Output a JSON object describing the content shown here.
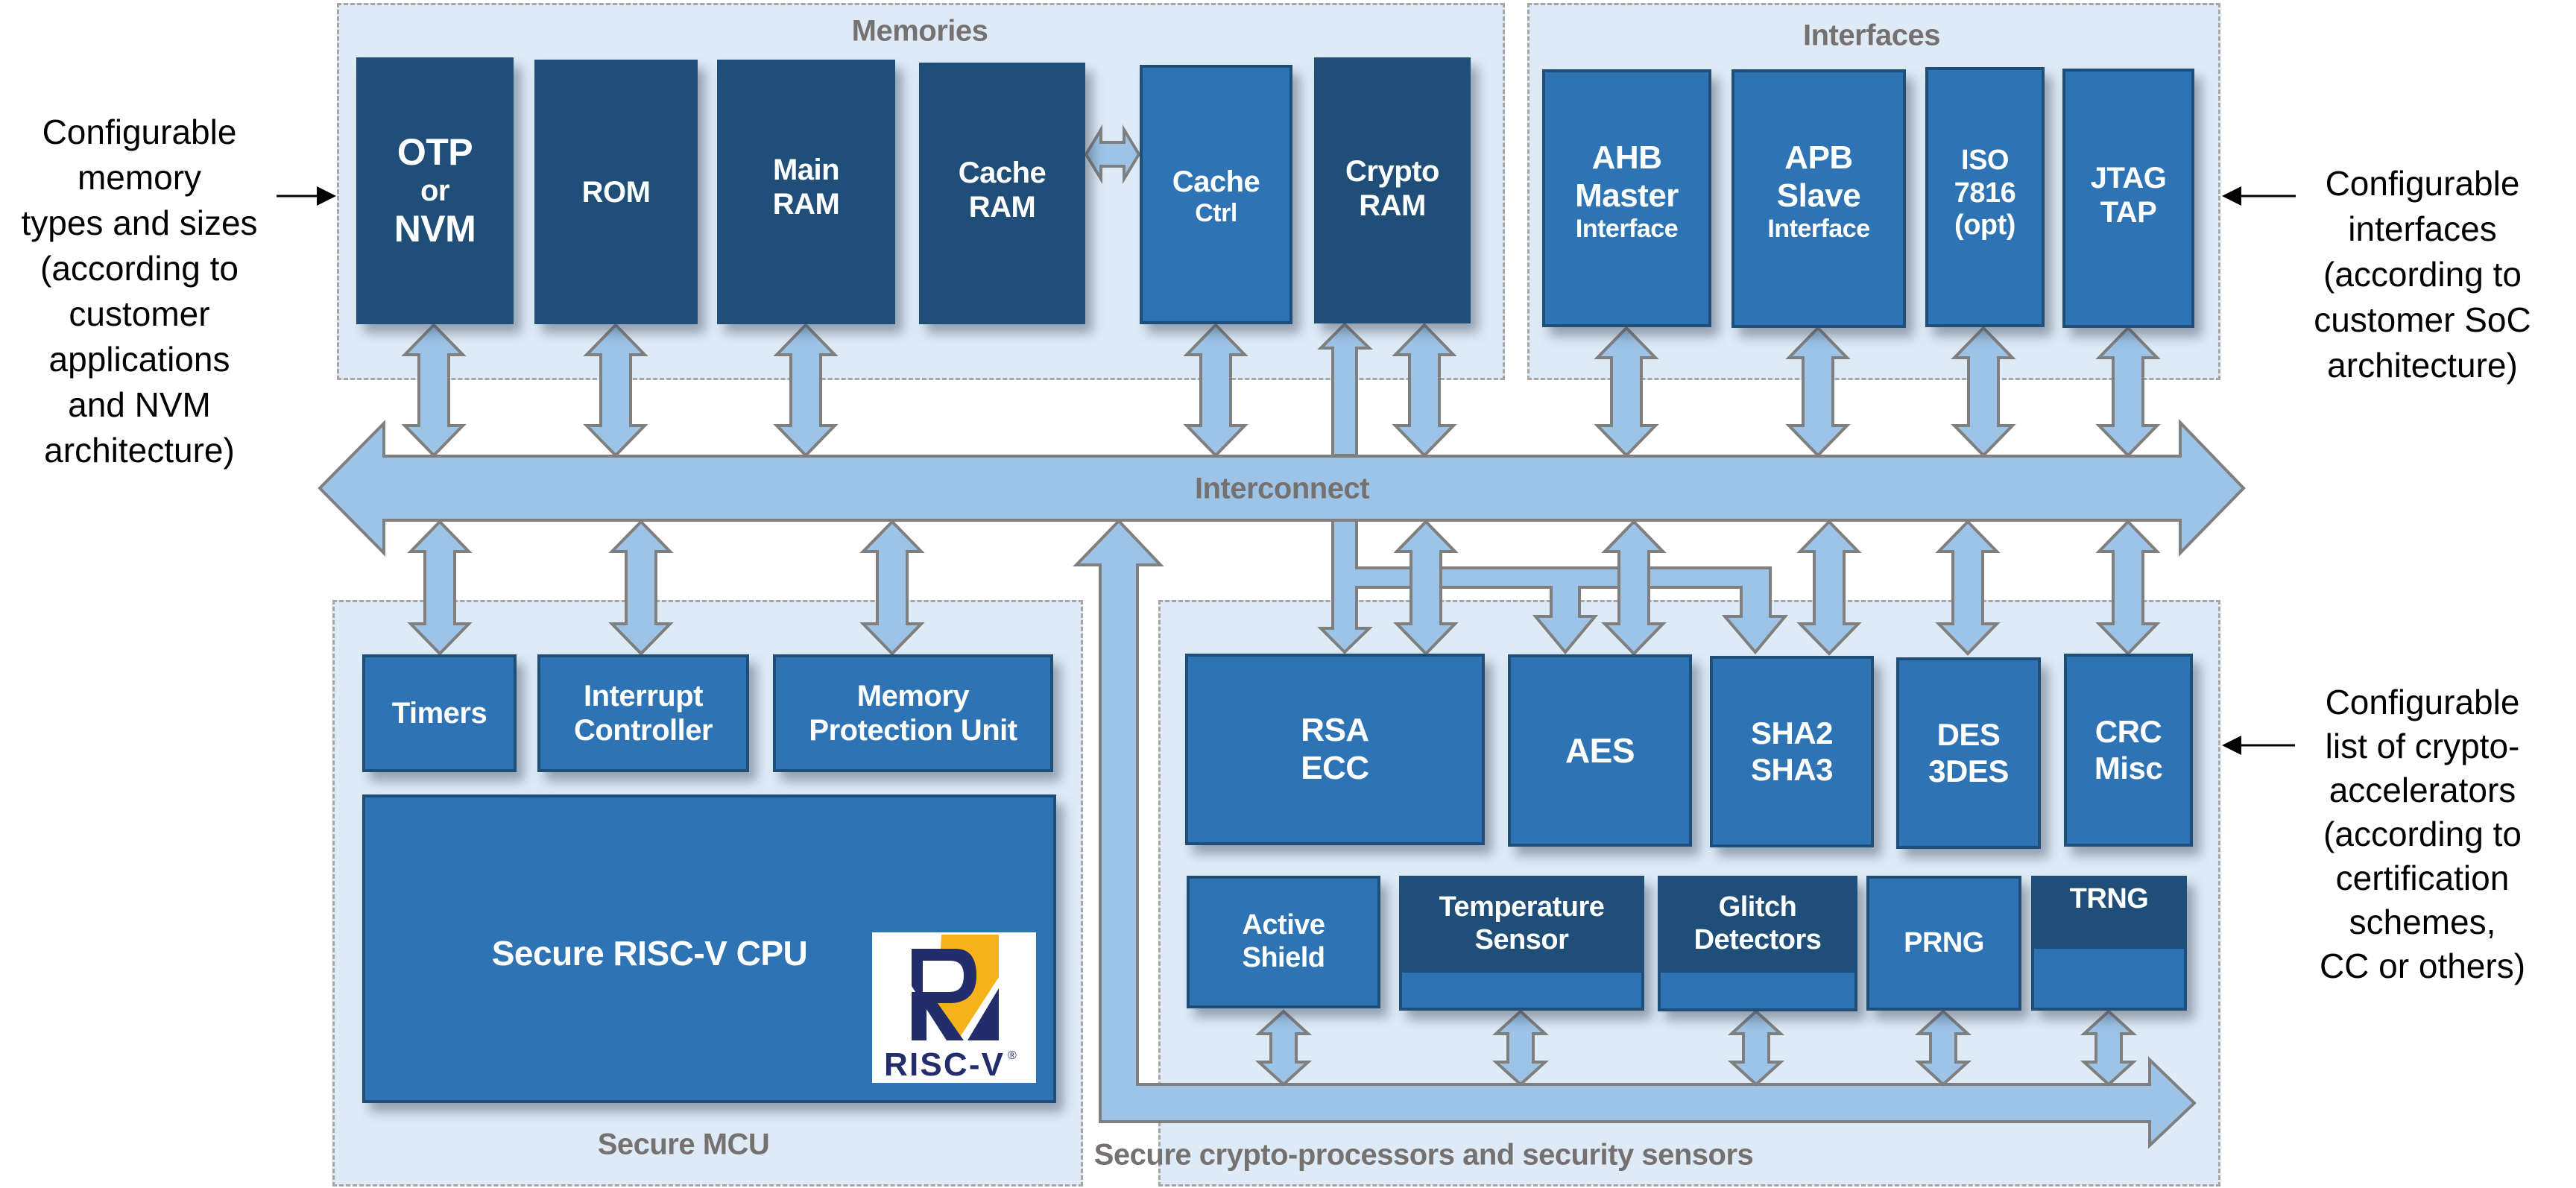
{
  "annotations": {
    "left": [
      "Configurable",
      "memory",
      "types and sizes",
      "(according to",
      "customer",
      "applications",
      "and NVM",
      "architecture)"
    ],
    "right_top": [
      "Configurable",
      "interfaces",
      "(according to",
      "customer SoC",
      "architecture)"
    ],
    "right_bottom": [
      "Configurable",
      "list of crypto-",
      "accelerators",
      "(according to",
      "certification",
      "schemes,",
      "CC or others)"
    ]
  },
  "memories": {
    "title": "Memories",
    "blocks": [
      {
        "lines": [
          "OTP",
          "or",
          "NVM"
        ]
      },
      {
        "lines": [
          "ROM"
        ]
      },
      {
        "lines": [
          "Main",
          "RAM"
        ]
      },
      {
        "lines": [
          "Cache",
          "RAM"
        ]
      },
      {
        "lines": [
          "Cache",
          "Ctrl"
        ]
      },
      {
        "lines": [
          "Crypto",
          "RAM"
        ]
      }
    ]
  },
  "interfaces": {
    "title": "Interfaces",
    "blocks": [
      {
        "lines": [
          "AHB",
          "Master",
          "Interface"
        ]
      },
      {
        "lines": [
          "APB",
          "Slave",
          "Interface"
        ]
      },
      {
        "lines": [
          "ISO",
          "7816",
          "(opt)"
        ]
      },
      {
        "lines": [
          "JTAG",
          "TAP"
        ]
      }
    ]
  },
  "interconnect": {
    "label": "Interconnect"
  },
  "mcu": {
    "title": "Secure MCU",
    "blocks": [
      {
        "lines": [
          "Timers"
        ]
      },
      {
        "lines": [
          "Interrupt",
          "Controller"
        ]
      },
      {
        "lines": [
          "Memory",
          "Protection Unit"
        ]
      }
    ],
    "cpu": {
      "label": "Secure RISC-V CPU",
      "logo_text": "RISC-V",
      "logo_mark": "®"
    }
  },
  "crypto": {
    "title": "Secure crypto-processors and security sensors",
    "accelerators": [
      {
        "lines": [
          "RSA",
          "ECC"
        ]
      },
      {
        "lines": [
          "AES"
        ]
      },
      {
        "lines": [
          "SHA2",
          "SHA3"
        ]
      },
      {
        "lines": [
          "DES",
          "3DES"
        ]
      },
      {
        "lines": [
          "CRC",
          "Misc"
        ]
      }
    ],
    "sensors": [
      {
        "lines": [
          "Active",
          "Shield"
        ]
      },
      {
        "lines": [
          "Temperature",
          "Sensor"
        ]
      },
      {
        "lines": [
          "Glitch",
          "Detectors"
        ]
      },
      {
        "lines": [
          "PRNG"
        ]
      },
      {
        "lines": [
          "TRNG"
        ]
      }
    ]
  },
  "colors": {
    "block_dark": "#1f4e79",
    "block_mid": "#2e74b5",
    "panel_fill": "#deebf7",
    "arrow_fill": "#9dc3e6",
    "arrow_stroke": "#7f7f7f",
    "title_text": "#767171",
    "logo_navy": "#232d6b",
    "logo_gold": "#f5b21b"
  }
}
